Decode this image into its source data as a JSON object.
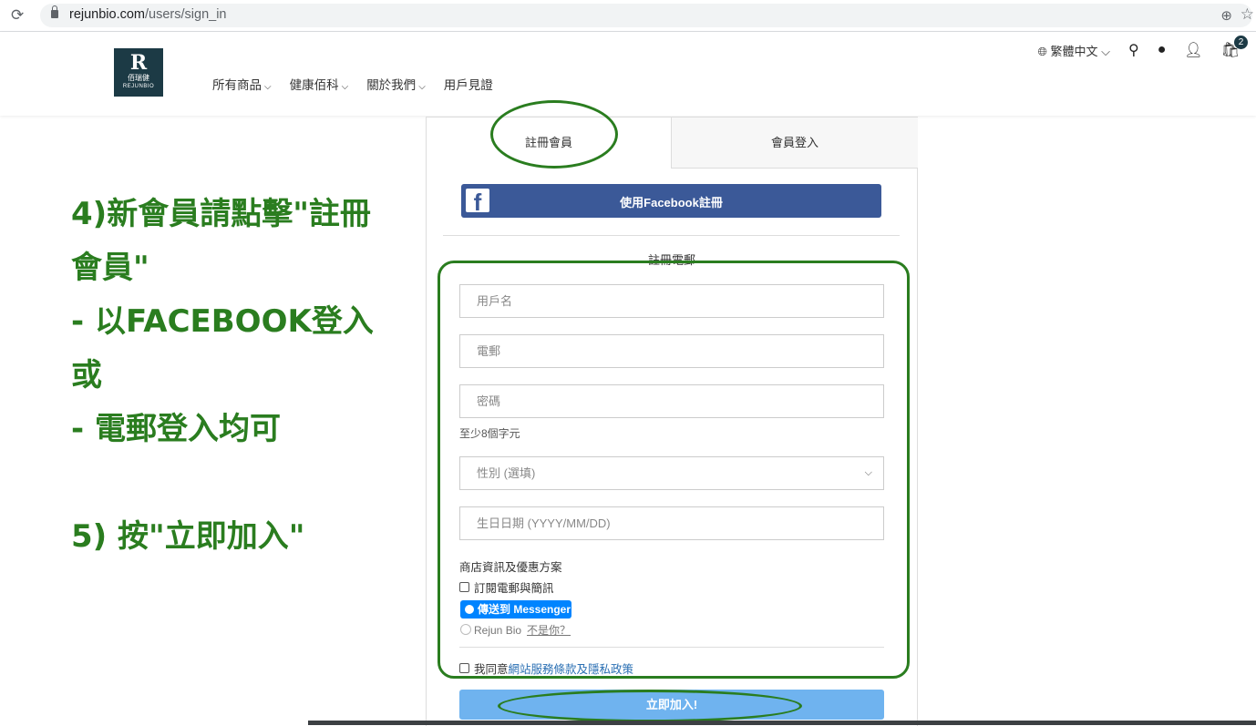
{
  "browser": {
    "url_domain": "rejunbio.com",
    "url_path": "/users/sign_in"
  },
  "header": {
    "logo": {
      "letter": "R",
      "cn": "佰瑞健",
      "en": "REJUNBIO"
    },
    "nav": [
      {
        "label": "所有商品",
        "has_dropdown": true
      },
      {
        "label": "健康佰科",
        "has_dropdown": true
      },
      {
        "label": "關於我們",
        "has_dropdown": true
      },
      {
        "label": "用戶見證",
        "has_dropdown": false
      }
    ],
    "language": "繁體中文",
    "cart_count": "2"
  },
  "annotation": {
    "lines": [
      "4)新會員請點擊\"註冊",
      "會員\"",
      "- 以FACEBOOK登入",
      "或",
      "- 電郵登入均可",
      "",
      "5) 按\"立即加入\""
    ],
    "color": "#2a7d1f"
  },
  "panel": {
    "tabs": [
      {
        "label": "註冊會員",
        "active": true
      },
      {
        "label": "會員登入",
        "active": false
      }
    ],
    "facebook_button": "使用Facebook註冊",
    "email_heading": "註冊電郵",
    "fields": {
      "username": {
        "placeholder": "用戶名"
      },
      "email": {
        "placeholder": "電郵"
      },
      "password": {
        "placeholder": "密碼"
      },
      "gender": {
        "value": "性別 (選填)"
      },
      "birthday": {
        "placeholder": "生日日期 (YYYY/MM/DD)"
      }
    },
    "password_hint": "至少8個字元",
    "shop_info_title": "商店資訊及優惠方案",
    "subscribe_label": "訂閱電郵與簡訊",
    "messenger_button": "傳送到 Messenger",
    "messenger_user": "Rejun Bio",
    "messenger_not_you": "不是你？",
    "terms_prefix": "我同意",
    "terms_link": "網站服務條款及隱私政策",
    "submit_button": "立即加入!",
    "colors": {
      "facebook": "#3b5998",
      "messenger": "#0084ff",
      "submit": "#6fb3ef"
    }
  }
}
